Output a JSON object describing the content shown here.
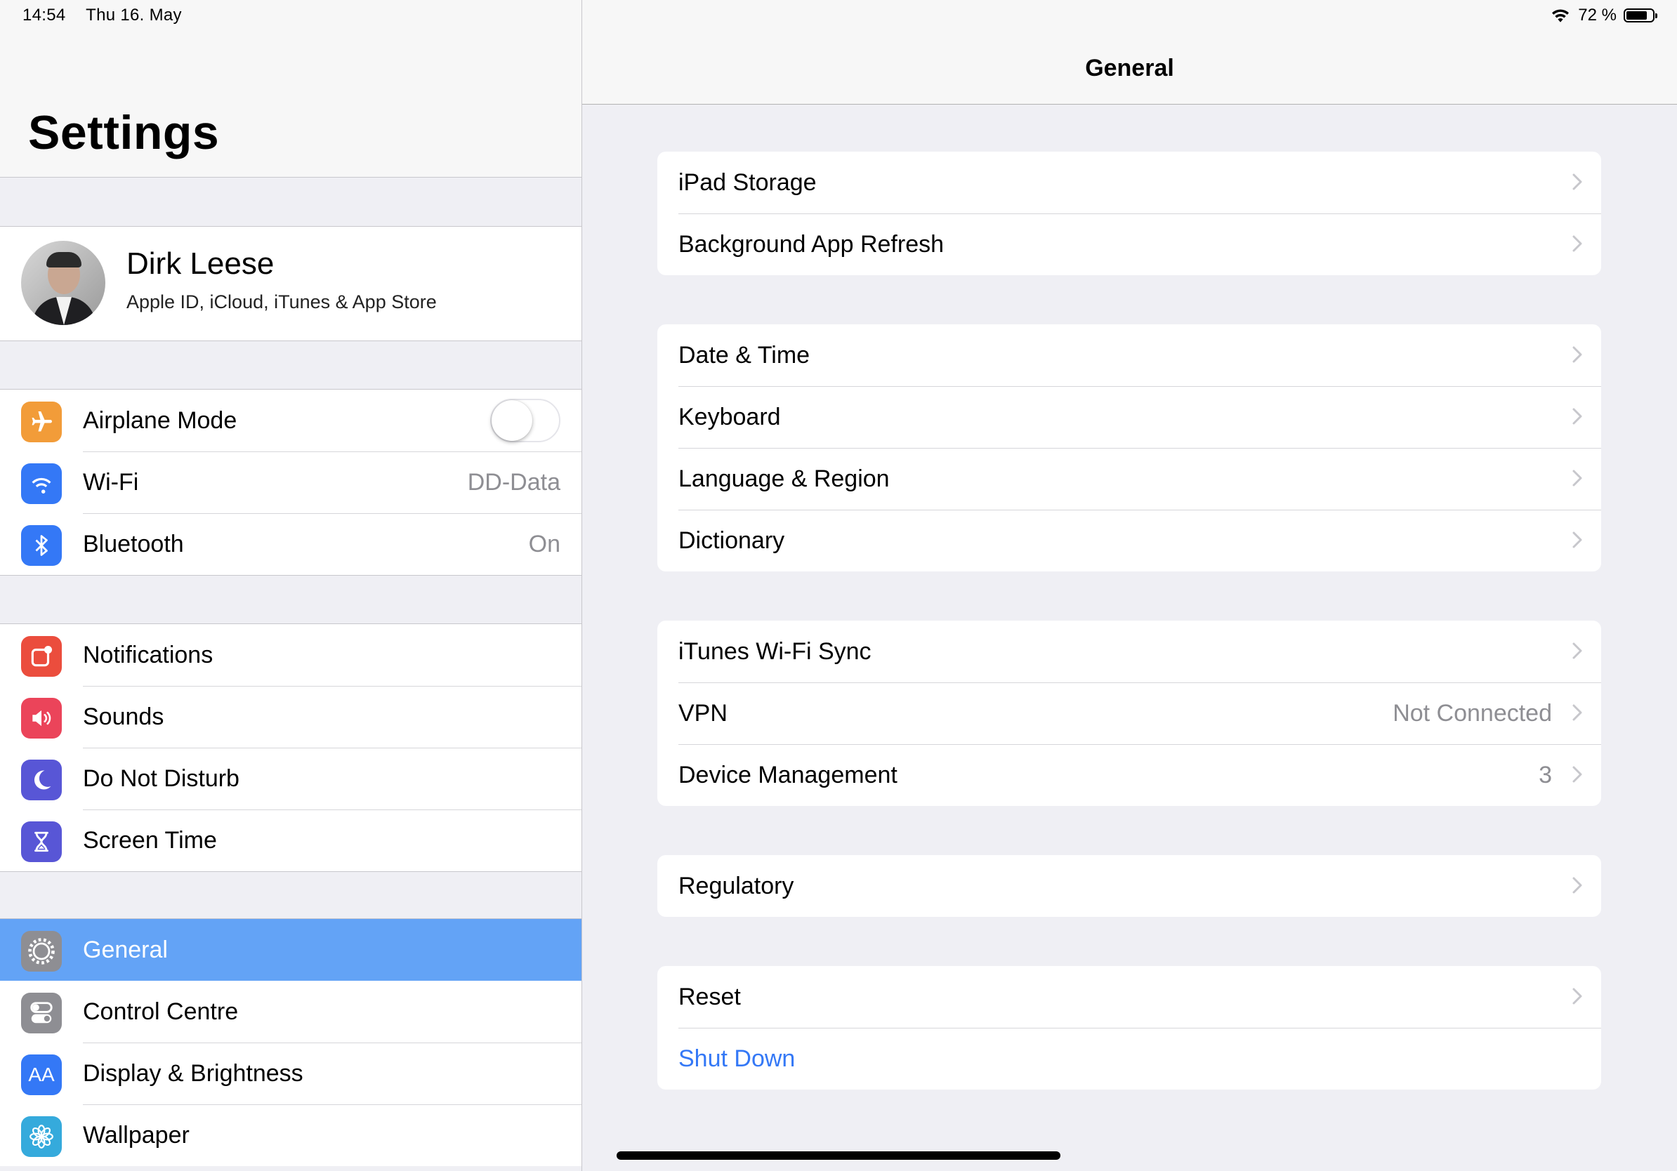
{
  "status_bar": {
    "time": "14:54",
    "date": "Thu 16. May",
    "battery": "72 %"
  },
  "sidebar": {
    "title": "Settings",
    "profile": {
      "name": "Dirk Leese",
      "subtitle": "Apple ID, iCloud, iTunes & App Store"
    },
    "group1": [
      {
        "label": "Airplane Mode",
        "icon": "airplane-icon",
        "color": "#f29c39",
        "toggle": false
      },
      {
        "label": "Wi-Fi",
        "icon": "wifi-icon",
        "color": "#3478f6",
        "value": "DD-Data"
      },
      {
        "label": "Bluetooth",
        "icon": "bluetooth-icon",
        "color": "#3478f6",
        "value": "On"
      }
    ],
    "group2": [
      {
        "label": "Notifications",
        "icon": "notifications-icon",
        "color": "#eb4d3d"
      },
      {
        "label": "Sounds",
        "icon": "sounds-icon",
        "color": "#eb445a"
      },
      {
        "label": "Do Not Disturb",
        "icon": "moon-icon",
        "color": "#5856d6"
      },
      {
        "label": "Screen Time",
        "icon": "hourglass-icon",
        "color": "#5856d6"
      }
    ],
    "group3": [
      {
        "label": "General",
        "icon": "gear-icon",
        "color": "#8e8e93",
        "selected": true
      },
      {
        "label": "Control Centre",
        "icon": "switches-icon",
        "color": "#8e8e93"
      },
      {
        "label": "Display & Brightness",
        "icon": "text-size-icon",
        "color": "#3478f6",
        "glyph": "AA"
      },
      {
        "label": "Wallpaper",
        "icon": "flower-icon",
        "color": "#35aadc"
      }
    ]
  },
  "detail": {
    "title": "General",
    "card1": [
      {
        "label": "iPad Storage"
      },
      {
        "label": "Background App Refresh"
      }
    ],
    "card2": [
      {
        "label": "Date & Time"
      },
      {
        "label": "Keyboard"
      },
      {
        "label": "Language & Region"
      },
      {
        "label": "Dictionary"
      }
    ],
    "card3": [
      {
        "label": "iTunes Wi-Fi Sync"
      },
      {
        "label": "VPN",
        "value": "Not Connected"
      },
      {
        "label": "Device Management",
        "value": "3"
      }
    ],
    "card4": [
      {
        "label": "Regulatory"
      }
    ],
    "card5": [
      {
        "label": "Reset"
      },
      {
        "label": "Shut Down",
        "link": true
      }
    ]
  },
  "colors": {
    "accent": "#3478f6",
    "selected_row": "#63a3f6",
    "background": "#efeff4"
  }
}
